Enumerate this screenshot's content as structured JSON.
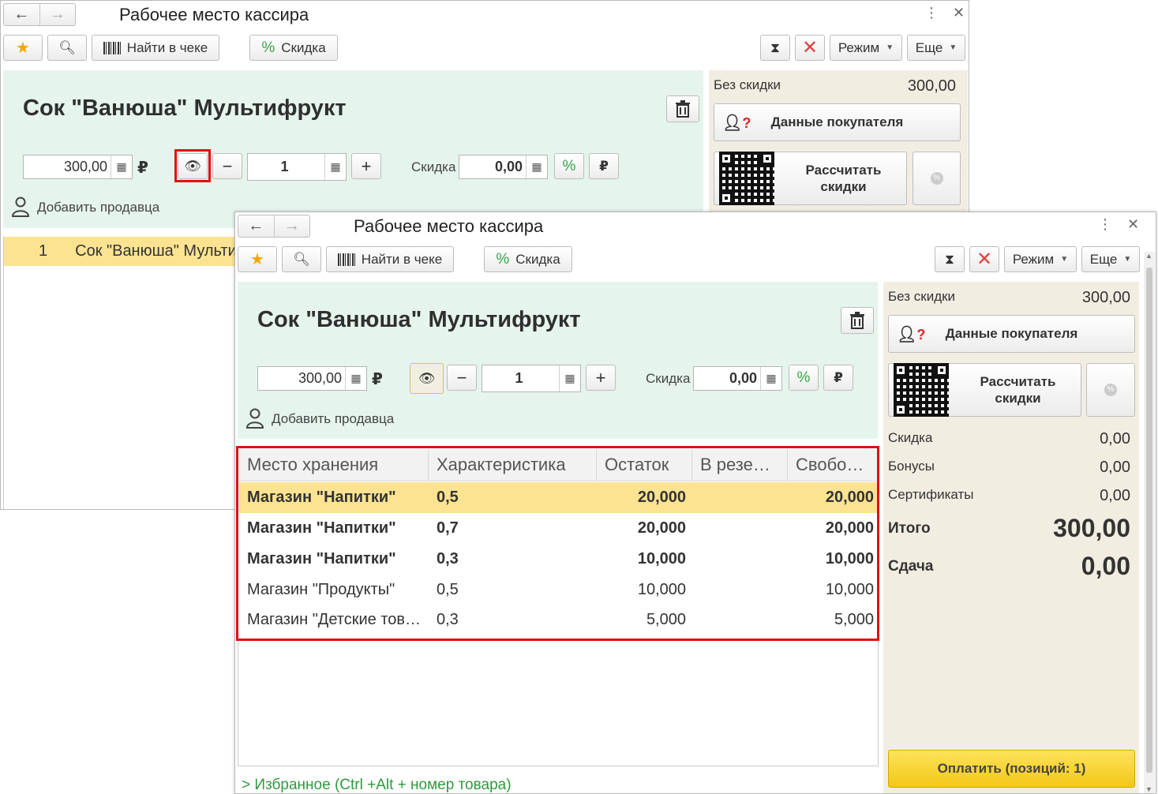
{
  "window_title": "Рабочее место кассира",
  "toolbar": {
    "find_in_receipt": "Найти в чеке",
    "discount": "Скидка",
    "mode": "Режим",
    "more": "Еще"
  },
  "product": {
    "name": "Сок \"Ванюша\" Мультифрукт",
    "price": "300,00",
    "currency": "₽",
    "quantity": "1",
    "discount_label": "Скидка",
    "discount_value": "0,00",
    "add_seller": "Добавить продавца"
  },
  "summary": {
    "no_discount_label": "Без скидки",
    "no_discount_value": "300,00",
    "customer_data": "Данные покупателя",
    "calc_discounts_line1": "Рассчитать",
    "calc_discounts_line2": "скидки",
    "discount_label": "Скидка",
    "discount_value": "0,00",
    "bonuses_label": "Бонусы",
    "bonuses_value": "0,00",
    "certificates_label": "Сертификаты",
    "certificates_value": "0,00",
    "total_label": "Итого",
    "total_value": "300,00",
    "change_label": "Сдача",
    "change_value": "0,00",
    "pay_button": "Оплатить (позиций: 1)"
  },
  "back_receipt_row": {
    "number": "1",
    "name": "Сок \"Ванюша\" Мульти"
  },
  "stock_table": {
    "columns": [
      "Место хранения",
      "Характеристика",
      "Остаток",
      "В резе…",
      "Свобо…"
    ],
    "rows": [
      {
        "place": "Магазин \"Напитки\"",
        "char": "0,5",
        "rest": "20,000",
        "reserve": "",
        "free": "20,000"
      },
      {
        "place": "Магазин \"Напитки\"",
        "char": "0,7",
        "rest": "20,000",
        "reserve": "",
        "free": "20,000"
      },
      {
        "place": "Магазин \"Напитки\"",
        "char": "0,3",
        "rest": "10,000",
        "reserve": "",
        "free": "10,000"
      },
      {
        "place": "Магазин \"Продукты\"",
        "char": "0,5",
        "rest": "10,000",
        "reserve": "",
        "free": "10,000"
      },
      {
        "place": "Магазин \"Детские тов…",
        "char": "0,3",
        "rest": "5,000",
        "reserve": "",
        "free": "5,000"
      }
    ]
  },
  "favorites": "Избранное (Ctrl +Alt + номер товара)",
  "colors": {
    "green_panel": "#e5f4ec",
    "beige_panel": "#f1ede1",
    "highlight_red": "#e01010",
    "selected_row": "#fbe392",
    "pay_yellow": "#f3c817"
  }
}
